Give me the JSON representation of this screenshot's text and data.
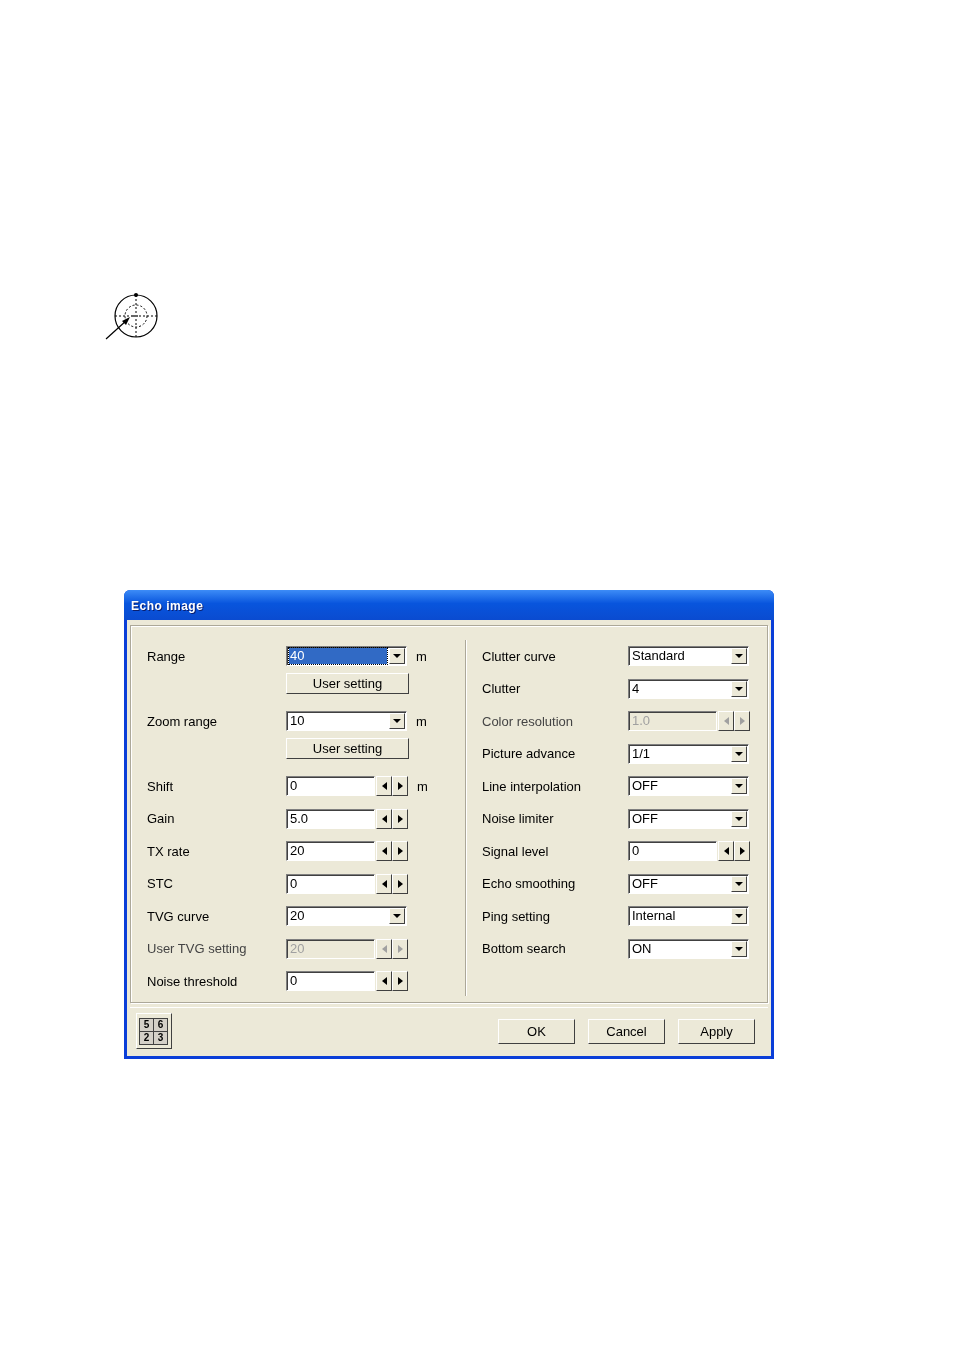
{
  "dialog": {
    "title": "Echo image",
    "left_rows": [
      {
        "label": "Range",
        "kind": "dropdown",
        "value": "40",
        "focused": true,
        "disabled": false,
        "unit": "m",
        "button": "User setting"
      },
      {
        "label": "Zoom range",
        "kind": "dropdown",
        "value": "10",
        "focused": false,
        "disabled": false,
        "unit": "m",
        "button": "User setting"
      },
      {
        "label": "Shift",
        "kind": "spinner",
        "value": "0",
        "focused": false,
        "disabled": false,
        "unit": "m"
      },
      {
        "label": "Gain",
        "kind": "spinner",
        "value": "5.0",
        "focused": false,
        "disabled": false
      },
      {
        "label": "TX rate",
        "kind": "spinner",
        "value": "20",
        "focused": false,
        "disabled": false
      },
      {
        "label": "STC",
        "kind": "spinner",
        "value": "0",
        "focused": false,
        "disabled": false
      },
      {
        "label": "TVG curve",
        "kind": "dropdown",
        "value": "20",
        "focused": false,
        "disabled": false
      },
      {
        "label": "User TVG setting",
        "kind": "spinner",
        "value": "20",
        "focused": false,
        "disabled": true
      },
      {
        "label": "Noise threshold",
        "kind": "spinner",
        "value": "0",
        "focused": false,
        "disabled": false
      }
    ],
    "right_rows": [
      {
        "label": "Clutter curve",
        "kind": "dropdown",
        "value": "Standard",
        "focused": false,
        "disabled": false
      },
      {
        "label": "Clutter",
        "kind": "dropdown",
        "value": "4",
        "focused": false,
        "disabled": false
      },
      {
        "label": "Color resolution",
        "kind": "spinner",
        "value": "1.0",
        "focused": false,
        "disabled": true
      },
      {
        "label": "Picture advance",
        "kind": "dropdown",
        "value": "1/1",
        "focused": false,
        "disabled": false
      },
      {
        "label": "Line interpolation",
        "kind": "dropdown",
        "value": "OFF",
        "focused": false,
        "disabled": false
      },
      {
        "label": "Noise limiter",
        "kind": "dropdown",
        "value": "OFF",
        "focused": false,
        "disabled": false
      },
      {
        "label": "Signal level",
        "kind": "spinner",
        "value": "0",
        "focused": false,
        "disabled": false
      },
      {
        "label": "Echo smoothing",
        "kind": "dropdown",
        "value": "OFF",
        "focused": false,
        "disabled": false
      },
      {
        "label": "Ping setting",
        "kind": "dropdown",
        "value": "Internal",
        "focused": false,
        "disabled": false
      },
      {
        "label": "Bottom search",
        "kind": "dropdown",
        "value": "ON",
        "focused": false,
        "disabled": false
      }
    ],
    "keypad_keys": [
      "5",
      "6",
      "2",
      "3"
    ],
    "buttons": [
      "OK",
      "Cancel",
      "Apply"
    ]
  }
}
